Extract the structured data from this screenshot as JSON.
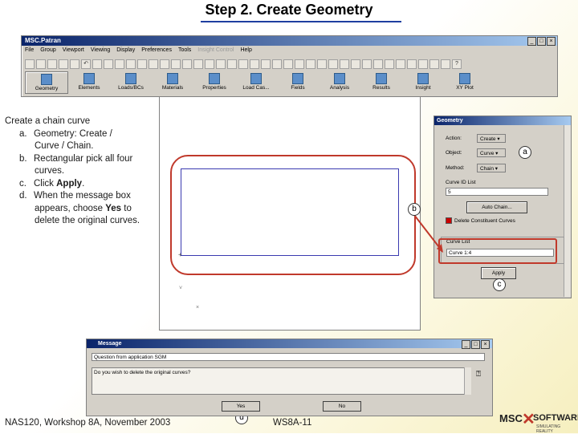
{
  "slide": {
    "title": "Step 2. Create Geometry",
    "footer_left": "NAS120, Workshop 8A, November 2003",
    "footer_center": "WS8A-11"
  },
  "patran": {
    "window_title": "MSC.Patran",
    "menu": [
      "File",
      "Group",
      "Viewport",
      "Viewing",
      "Display",
      "Preferences",
      "Tools",
      "Insight Control",
      "Help"
    ],
    "apps": [
      "Geometry",
      "Elements",
      "Loads/BCs",
      "Materials",
      "Properties",
      "Load Cas...",
      "Fields",
      "Analysis",
      "Results",
      "Insight",
      "XY Plot"
    ],
    "selected_app": "Geometry"
  },
  "instructions": {
    "heading": "Create a chain curve",
    "items": [
      {
        "key": "a.",
        "lines": [
          "Geometry: Create /",
          "Curve / Chain."
        ]
      },
      {
        "key": "b.",
        "lines": [
          "Rectangular pick all four",
          "curves."
        ]
      },
      {
        "key": "c.",
        "pre": "Click ",
        "bold": "Apply",
        "post": "."
      },
      {
        "key": "d.",
        "lines": [
          "When the message box"
        ],
        "line2_pre": "appears, choose ",
        "line2_bold": "Yes",
        "line2_post": " to",
        "line3": "delete the original curves."
      }
    ]
  },
  "geometry_panel": {
    "title": "Geometry",
    "action_label": "Action:",
    "action_value": "Create",
    "object_label": "Object:",
    "object_value": "Curve",
    "method_label": "Method:",
    "method_value": "Chain",
    "curve_id_label": "Curve ID List",
    "curve_id_value": "5",
    "auto_chain_button": "Auto Chain...",
    "delete_checkbox_label": "Delete Constituent Curves",
    "curve_list_label": "Curve List",
    "curve_list_value": "Curve 1:4",
    "apply_button": "Apply"
  },
  "callouts": {
    "a": "a",
    "b": "b",
    "c": "c",
    "d": "d"
  },
  "message_dialog": {
    "title": "Message",
    "line1": "Question from application SGM",
    "question": "Do you wish to delete the original curves?",
    "yes_button": "Yes",
    "no_button": "No"
  },
  "logo": {
    "text_left": "MSC",
    "text_right": "SOFTWARE",
    "tagline": "SIMULATING REALITY"
  },
  "colors": {
    "highlight": "#c0392b",
    "title_rule": "#1f3fa0",
    "curve": "#3a3ab0"
  }
}
